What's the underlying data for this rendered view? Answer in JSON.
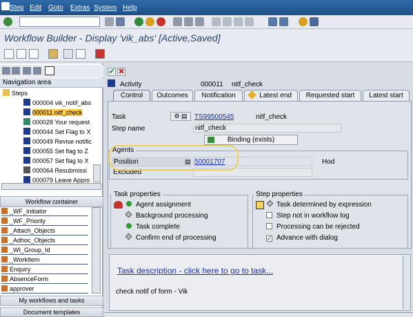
{
  "menu": [
    "Step",
    "Edit",
    "Goto",
    "Extras",
    "System",
    "Help"
  ],
  "title": "Workflow Builder - Display 'vik_abs' [Active,Saved]",
  "nav": {
    "header": "Navigation area",
    "root": "Steps",
    "items": [
      "000004 vik_notif_abs",
      "000011 nitf_check",
      "000028 Your request",
      "000044 Set Flag to X",
      "000049 Revise notific",
      "000055 Set flag to Z",
      "000057 Set flag to X",
      "000064 Resubmissi",
      "000079 Leave Appro"
    ],
    "selected_index": 1
  },
  "workflow_container": {
    "header": "Workflow container",
    "items": [
      "_WF_Initiator",
      "_WF_Priority",
      "_Attach_Objects",
      "_Adhoc_Objects",
      "_WI_Group_Id",
      "_WorkItem",
      "Enquiry",
      "AbsenceForm",
      "approver"
    ]
  },
  "my_workflows": "My workflows and tasks",
  "doc_templates": "Document templates",
  "activity": {
    "label": "Activity",
    "number": "000011",
    "name": "nitf_check"
  },
  "tabs": [
    "Control",
    "Outcomes",
    "Notification",
    "Latest end",
    "Requested start",
    "Latest start"
  ],
  "control": {
    "task_label": "Task",
    "task_id": "TS99500545",
    "task_name": "nitf_check",
    "step_name_label": "Step name",
    "step_name": "nitf_check",
    "binding_button": "Binding (exists)",
    "agents_title": "Agents",
    "position_label": "Position",
    "position_value": "50001707",
    "position_name": "Hod",
    "excluded_label": "Excluded"
  },
  "task_properties": {
    "title": "Task properties",
    "items": [
      "Agent assignment",
      "Background processing",
      "Task complete",
      "Confirm end of processing"
    ]
  },
  "step_properties": {
    "title": "Step properties",
    "items": [
      {
        "label": "Task determined by expression",
        "checked": null
      },
      {
        "label": "Step not in workflow log",
        "checked": false
      },
      {
        "label": "Processing can be rejected",
        "checked": false
      },
      {
        "label": "Advance with dialog",
        "checked": true
      }
    ]
  },
  "description": {
    "link": "Task description - click here to go to task...",
    "text": "check notif of form - Vik"
  }
}
